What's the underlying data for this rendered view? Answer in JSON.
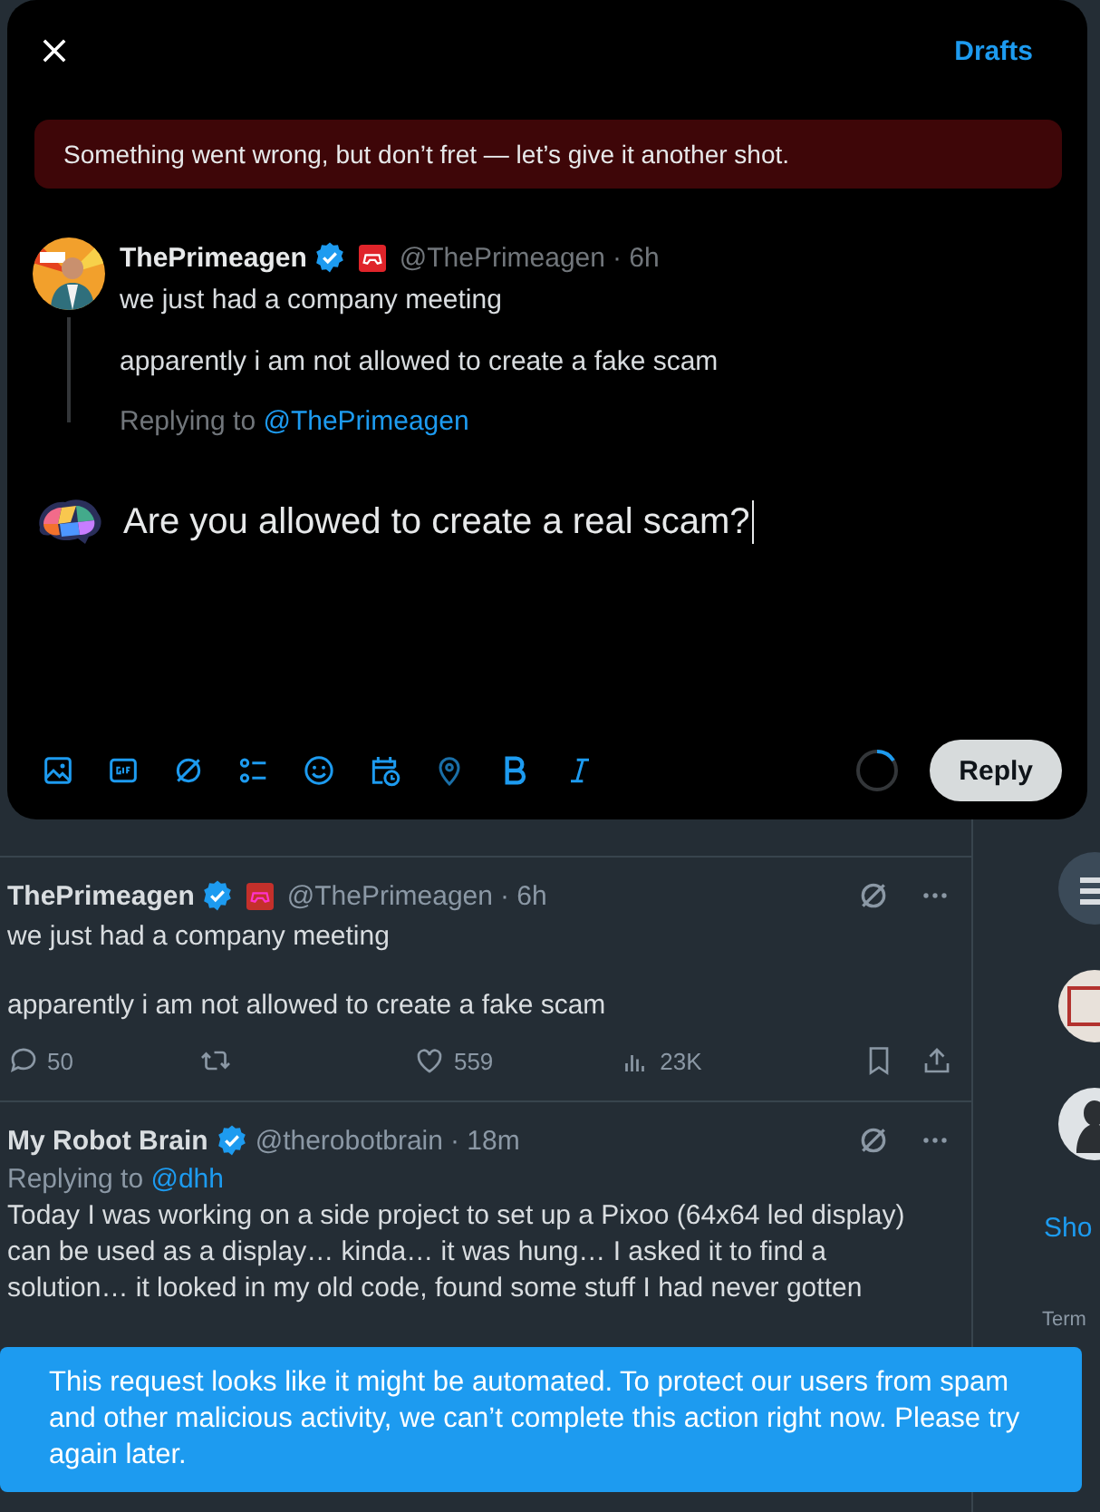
{
  "modal": {
    "drafts": "Drafts",
    "error": "Something went wrong, but don’t fret — let’s give it another shot.",
    "quoted": {
      "name": "ThePrimeagen",
      "verified": true,
      "handle": "@ThePrimeagen",
      "time": "· 6h",
      "paragraphs": [
        "we just had a company meeting",
        "apparently i am not allowed to create a fake scam"
      ],
      "replying_prefix": "Replying to",
      "replying_to": "@ThePrimeagen"
    },
    "compose": {
      "value": "Are you allowed to create a real scam?"
    },
    "reply_button": "Reply"
  },
  "timeline": {
    "tweets": [
      {
        "name": "ThePrimeagen",
        "verified": true,
        "handle": "@ThePrimeagen",
        "time": "· 6h",
        "paragraphs": [
          "we just had a company meeting",
          "apparently i am not allowed to create a fake scam"
        ],
        "stats": {
          "replies": "50",
          "likes": "559",
          "views": "23K"
        }
      },
      {
        "name": "My Robot Brain",
        "verified": true,
        "handle": "@therobotbrain",
        "time": "· 18m",
        "replying_prefix": "Replying to",
        "replying_to": "@dhh",
        "paragraphs": [
          "Today I was working on a side project to set up a Pixoo (64x64 led display)\ncan be used as a display… kinda… it was hung… I asked it to find a\nsolution… it looked in my old code, found some stuff I had never gotten"
        ]
      }
    ]
  },
  "sidebar": {
    "link": "Sho",
    "footer": "Term"
  },
  "toast": "This request looks like it might be automated. To protect our users from spam and other malicious activity, we can’t complete this action right now. Please try again later."
}
